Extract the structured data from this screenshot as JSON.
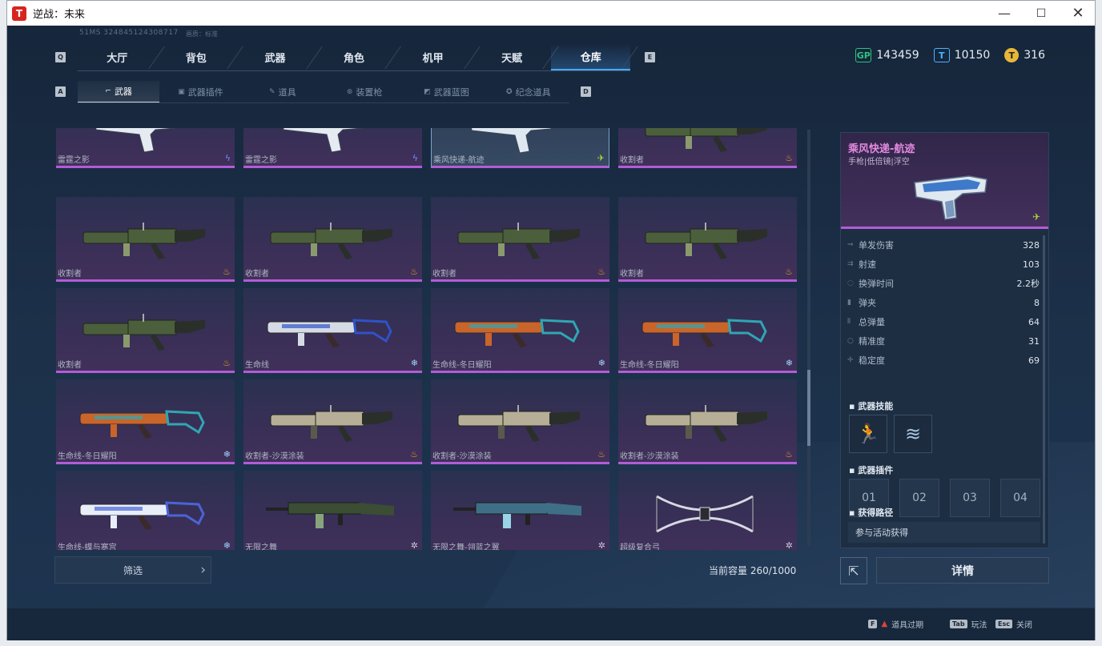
{
  "window": {
    "title": "逆战：未来",
    "app_icon": "T"
  },
  "header": {
    "uid": "51MS  324845124308717",
    "quality": "画质：标准",
    "tab_left_key": "Q",
    "tab_right_key": "E",
    "tabs": [
      {
        "label": "大厅"
      },
      {
        "label": "背包"
      },
      {
        "label": "武器"
      },
      {
        "label": "角色"
      },
      {
        "label": "机甲"
      },
      {
        "label": "天赋"
      },
      {
        "label": "仓库"
      }
    ],
    "active_tab": "仓库",
    "sub_left_key": "A",
    "sub_right_key": "D",
    "subtabs": [
      {
        "label": "武器",
        "icon": "gun-icon"
      },
      {
        "label": "武器插件",
        "icon": "chip-icon"
      },
      {
        "label": "道具",
        "icon": "item-icon"
      },
      {
        "label": "装置枪",
        "icon": "device-icon"
      },
      {
        "label": "武器蓝图",
        "icon": "blueprint-icon"
      },
      {
        "label": "纪念道具",
        "icon": "medal-icon"
      }
    ]
  },
  "currency": [
    {
      "icon": "gp-icon",
      "symbol": "GP",
      "value": "143459",
      "color": "#2ec27e"
    },
    {
      "icon": "ticket-icon",
      "symbol": "T",
      "value": "10150",
      "color": "#4ab3ff"
    },
    {
      "icon": "coin-icon",
      "symbol": "T",
      "value": "316",
      "color": "#e8b73a"
    }
  ],
  "grid": {
    "items": [
      {
        "name": "雷霆之影",
        "badge": "lightning",
        "gun": "pistol-white"
      },
      {
        "name": "雷霆之影",
        "badge": "lightning",
        "gun": "pistol-white"
      },
      {
        "name": "乘风快递-航迹",
        "badge": "wing",
        "gun": "pistol-blue",
        "selected": true
      },
      {
        "name": "收割者",
        "badge": "fire",
        "gun": "launcher-green"
      },
      {
        "name": "收割者",
        "badge": "fire",
        "gun": "launcher-green"
      },
      {
        "name": "收割者",
        "badge": "fire",
        "gun": "launcher-green"
      },
      {
        "name": "收割者",
        "badge": "fire",
        "gun": "launcher-green"
      },
      {
        "name": "收割者",
        "badge": "fire",
        "gun": "launcher-green"
      },
      {
        "name": "收割者",
        "badge": "fire",
        "gun": "launcher-green"
      },
      {
        "name": "生命线",
        "badge": "snow",
        "gun": "rifle-white"
      },
      {
        "name": "生命线-冬日耀阳",
        "badge": "snow",
        "gun": "rifle-orange"
      },
      {
        "name": "生命线-冬日耀阳",
        "badge": "snow",
        "gun": "rifle-orange"
      },
      {
        "name": "生命线-冬日耀阳",
        "badge": "snow",
        "gun": "rifle-orange"
      },
      {
        "name": "收割者-沙漠涂装",
        "badge": "fire",
        "gun": "launcher-sand"
      },
      {
        "name": "收割者-沙漠涂装",
        "badge": "fire",
        "gun": "launcher-sand"
      },
      {
        "name": "收割者-沙漠涂装",
        "badge": "fire",
        "gun": "launcher-sand"
      },
      {
        "name": "生命线-蝶与寒宫",
        "badge": "snow",
        "gun": "rifle-ice"
      },
      {
        "name": "无限之舞",
        "badge": "star",
        "gun": "ar-green"
      },
      {
        "name": "无限之舞-翎蓝之翼",
        "badge": "star",
        "gun": "ar-blue"
      },
      {
        "name": "超级复合弓",
        "badge": "star",
        "gun": "bow"
      }
    ]
  },
  "filter": {
    "label": "筛选"
  },
  "capacity": "当前容量 260/1000",
  "detail_panel": {
    "name": "乘风快递-航迹",
    "type": "手枪|低倍镜|浮空",
    "stats": [
      {
        "label": "单发伤害",
        "value": "328",
        "icon": "damage-icon"
      },
      {
        "label": "射速",
        "value": "103",
        "icon": "firerate-icon"
      },
      {
        "label": "换弹时间",
        "value": "2.2秒",
        "icon": "reload-icon"
      },
      {
        "label": "弹夹",
        "value": "8",
        "icon": "magazine-icon"
      },
      {
        "label": "总弹量",
        "value": "64",
        "icon": "ammo-icon"
      },
      {
        "label": "精准度",
        "value": "31",
        "icon": "accuracy-icon"
      },
      {
        "label": "稳定度",
        "value": "69",
        "icon": "stability-icon"
      }
    ],
    "skills_title": "武器技能",
    "plugins_title": "武器插件",
    "plugin_slots": [
      "01",
      "02",
      "03",
      "04"
    ],
    "source_title": "获得路径",
    "source": "参与活动获得"
  },
  "detail_button": "详情",
  "footer": [
    {
      "key": "F",
      "label": "道具过期"
    },
    {
      "key": "Tab",
      "label": "玩法"
    },
    {
      "key": "Esc",
      "label": "关闭"
    }
  ],
  "badge_glyphs": {
    "lightning": "ϟ",
    "fire": "♨",
    "snow": "❄",
    "wing": "✈",
    "star": "✲"
  },
  "badge_colors": {
    "lightning": "#6f8cff",
    "fire": "#f0a020",
    "snow": "#9fd2ff",
    "wing": "#b4d43a",
    "star": "#c9c9d6"
  }
}
